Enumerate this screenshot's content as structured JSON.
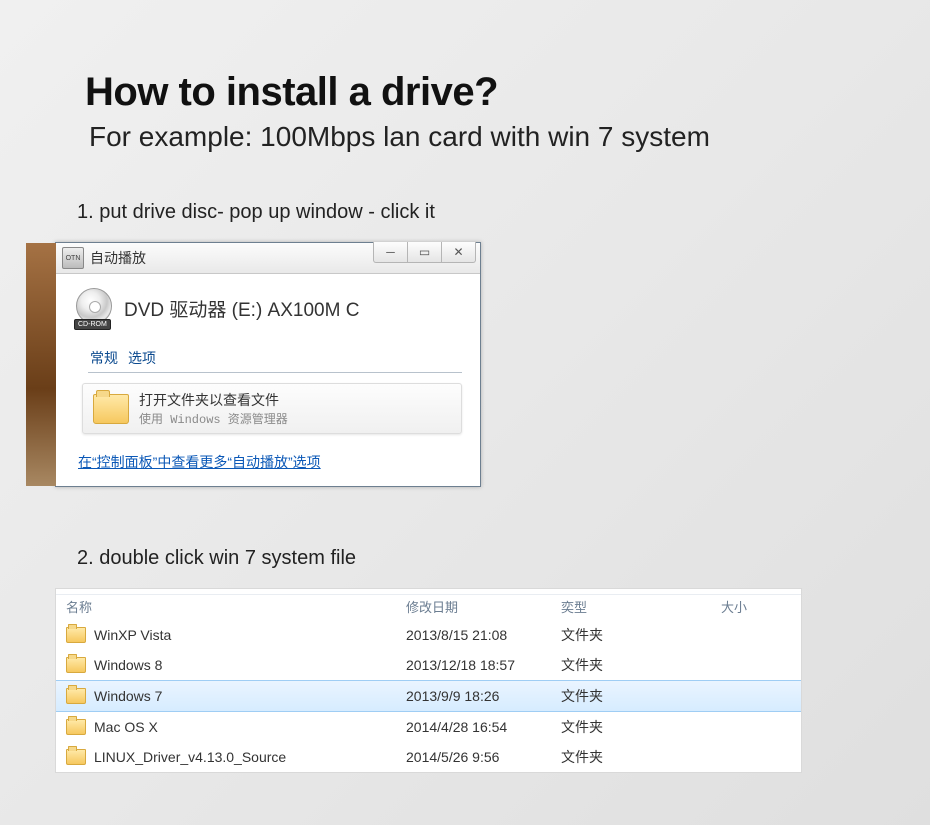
{
  "title": "How to install a drive?",
  "subtitle": "For example: 100Mbps lan card with win 7 system",
  "step1": "1. put drive disc- pop up window - click it",
  "step2": "2. double click win 7 system file",
  "autoplay": {
    "window_title": "自动播放",
    "icon_text": "OTN",
    "drive_label": "DVD 驱动器 (E:) AX100M C",
    "cdrom_badge": "CD-ROM",
    "tab1": "常规",
    "tab2": "选项",
    "open_line1": "打开文件夹以查看文件",
    "open_line2": "使用 Windows 资源管理器",
    "cp_link": "在“控制面板”中查看更多“自动播放”选项"
  },
  "explorer": {
    "headers": {
      "name": "名称",
      "date": "修改日期",
      "type": "奕型",
      "size": "大小"
    },
    "rows": [
      {
        "name": "WinXP Vista",
        "date": "2013/8/15 21:08",
        "type": "文件夹",
        "selected": false
      },
      {
        "name": "Windows 8",
        "date": "2013/12/18 18:57",
        "type": "文件夹",
        "selected": false
      },
      {
        "name": "Windows 7",
        "date": "2013/9/9 18:26",
        "type": "文件夹",
        "selected": true
      },
      {
        "name": "Mac OS X",
        "date": "2014/4/28 16:54",
        "type": "文件夹",
        "selected": false
      },
      {
        "name": "LINUX_Driver_v4.13.0_Source",
        "date": "2014/5/26 9:56",
        "type": "文件夹",
        "selected": false
      }
    ]
  }
}
